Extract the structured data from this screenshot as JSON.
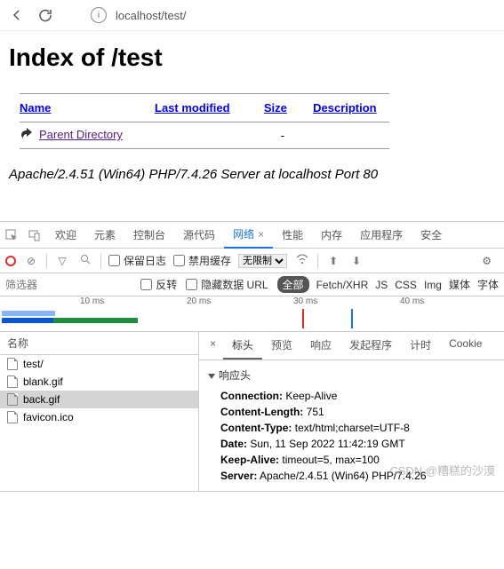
{
  "browser": {
    "url": "localhost/test/"
  },
  "page": {
    "title": "Index of /test",
    "cols": {
      "name": "Name",
      "modified": "Last modified",
      "size": "Size",
      "desc": "Description"
    },
    "parent": "Parent Directory",
    "parent_size": "-",
    "server": "Apache/2.4.51 (Win64) PHP/7.4.26 Server at localhost Port 80"
  },
  "devtools": {
    "tabs": {
      "welcome": "欢迎",
      "elements": "元素",
      "console": "控制台",
      "sources": "源代码",
      "network": "网络",
      "performance": "性能",
      "memory": "内存",
      "application": "应用程序",
      "security": "安全"
    },
    "toolbar": {
      "preserve": "保留日志",
      "disable_cache": "禁用缓存",
      "throttle": "无限制"
    },
    "filter": {
      "placeholder": "筛选器",
      "invert": "反转",
      "hide_data": "隐藏数据 URL",
      "all": "全部",
      "fetch": "Fetch/XHR",
      "js": "JS",
      "css": "CSS",
      "img": "Img",
      "media": "媒体",
      "font": "字体"
    },
    "timeline": {
      "t1": "10 ms",
      "t2": "20 ms",
      "t3": "30 ms",
      "t4": "40 ms"
    },
    "name_col": "名称",
    "requests": [
      {
        "name": "test/"
      },
      {
        "name": "blank.gif"
      },
      {
        "name": "back.gif"
      },
      {
        "name": "favicon.ico"
      }
    ],
    "detail_tabs": {
      "headers": "标头",
      "preview": "预览",
      "response": "响应",
      "initiator": "发起程序",
      "timing": "计时",
      "cookies": "Cookie"
    },
    "response_headers_title": "响应头",
    "headers": [
      {
        "k": "Connection:",
        "v": "Keep-Alive"
      },
      {
        "k": "Content-Length:",
        "v": "751"
      },
      {
        "k": "Content-Type:",
        "v": "text/html;charset=UTF-8"
      },
      {
        "k": "Date:",
        "v": "Sun, 11 Sep 2022 11:42:19 GMT"
      },
      {
        "k": "Keep-Alive:",
        "v": "timeout=5, max=100"
      },
      {
        "k": "Server:",
        "v": "Apache/2.4.51 (Win64) PHP/7.4.26"
      }
    ]
  },
  "watermark": "CSDN @糟糕的沙漠"
}
